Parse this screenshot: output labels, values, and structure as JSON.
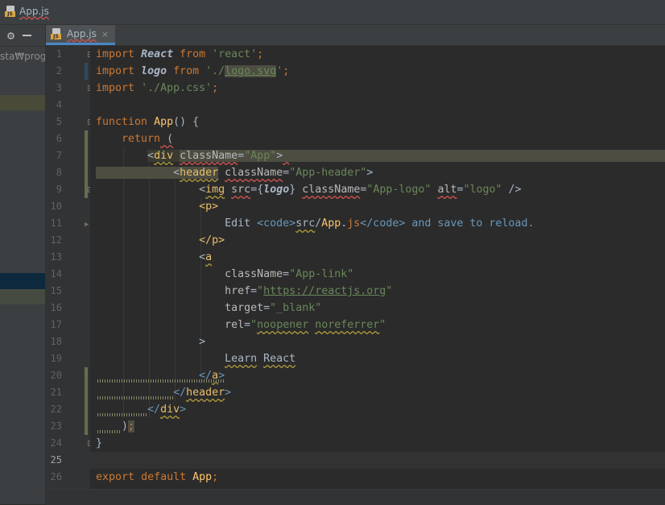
{
  "window": {
    "title": "App.js"
  },
  "sidebar": {
    "path_text": "sta₩progra"
  },
  "tabs": [
    {
      "label": "App.js",
      "close": "×"
    }
  ],
  "editor": {
    "line_numbers": [
      "1",
      "2",
      "3",
      "4",
      "5",
      "6",
      "7",
      "8",
      "9",
      "10",
      "11",
      "12",
      "13",
      "14",
      "15",
      "16",
      "17",
      "18",
      "19",
      "20",
      "21",
      "22",
      "23",
      "24",
      "25",
      "26"
    ],
    "code": {
      "l1_import": "import",
      "l1_react": "React",
      "l1_from": "from",
      "l1_str": "'react'",
      "l1_semi": ";",
      "l2_import": "import",
      "l2_logo": "logo",
      "l2_from": "from",
      "l2_q": "'./",
      "l2_file": "logo.svg",
      "l2_q2": "'",
      "l2_semi": ";",
      "l3_import": "import",
      "l3_str": "'./App.css'",
      "l3_semi": ";",
      "l5_function": "function",
      "l5_name": "App",
      "l5_rest": "() {",
      "l6_return": "return",
      "l6_paren": " (",
      "l7_open": "<",
      "l7_tag": "div",
      "l7_attr": "className",
      "l7_eq": "=",
      "l7_val": "\"App\"",
      "l7_close": ">",
      "l8_open": "<",
      "l8_tag": "header",
      "l8_attr": "className",
      "l8_eq": "=",
      "l8_val": "\"App-header\"",
      "l8_close": ">",
      "l9_open": "<",
      "l9_tag": "img",
      "l9_attr1": "src",
      "l9_eq1": "=",
      "l9_b1": "{",
      "l9_logo": "logo",
      "l9_b2": "}",
      "l9_attr2": "className",
      "l9_eq2": "=",
      "l9_val2": "\"App-logo\"",
      "l9_attr3": "alt",
      "l9_eq3": "=",
      "l9_val3": "\"logo\"",
      "l9_end": " />",
      "l10_text": "<p>",
      "l11_edit": "Edit ",
      "l11_code_open": "<code>",
      "l11_src": "src",
      "l11_slash": "/",
      "l11_app": "App",
      "l11_dot": ".",
      "l11_js": "js",
      "l11_code_close": "</code>",
      "l11_rest": " and save to reload.",
      "l12_text": "</p>",
      "l13_open": "<",
      "l13_tag": "a",
      "l14_attr": "className",
      "l14_eq": "=",
      "l14_val": "\"App-link\"",
      "l15_attr": "href",
      "l15_eq": "=",
      "l15_q1": "\"",
      "l15_url": "https://reactjs.org",
      "l15_q2": "\"",
      "l16_attr": "target",
      "l16_eq": "=",
      "l16_val": "\"_blank\"",
      "l17_attr": "rel",
      "l17_eq": "=",
      "l17_q1": "\"",
      "l17_w1": "noopener",
      "l17_sp": " ",
      "l17_w2": "noreferrer",
      "l17_q2": "\"",
      "l18_text": ">",
      "l19_w1": "Learn",
      "l19_sp": " ",
      "l19_w2": "React",
      "l20_open": "</",
      "l20_tag": "a",
      "l20_close": ">",
      "l21_open": "</",
      "l21_tag": "header",
      "l21_close": ">",
      "l22_open": "</",
      "l22_tag": "div",
      "l22_close": ">",
      "l23_paren": ")",
      "l23_semi": ";",
      "l24_text": "}",
      "l26_export": "export",
      "l26_default": "default",
      "l26_app": "App",
      "l26_semi": ";"
    }
  },
  "colors": {
    "keyword": "#cc7832",
    "string": "#6a8759",
    "tag": "#e8bf6a",
    "function": "#ffc66d",
    "code_tag": "#6897bb",
    "background": "#2b2b2b"
  }
}
